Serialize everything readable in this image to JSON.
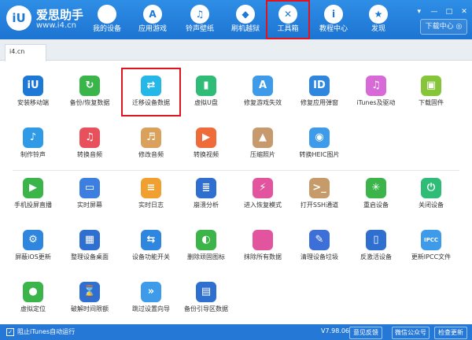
{
  "app": {
    "logo_text": "iU",
    "name": "爱思助手",
    "url": "www.i4.cn"
  },
  "nav": {
    "items": [
      {
        "label": "我的设备",
        "icon": "apple-icon",
        "glyph": ""
      },
      {
        "label": "应用游戏",
        "icon": "app-store-icon",
        "glyph": "A"
      },
      {
        "label": "铃声壁纸",
        "icon": "ringtone-icon",
        "glyph": "♫"
      },
      {
        "label": "刷机越狱",
        "icon": "dropbox-icon",
        "glyph": "◆"
      },
      {
        "label": "工具箱",
        "icon": "tools-icon",
        "glyph": "✕"
      },
      {
        "label": "教程中心",
        "icon": "info-icon",
        "glyph": "i"
      },
      {
        "label": "发现",
        "icon": "star-icon",
        "glyph": "★"
      }
    ],
    "active_index": 4
  },
  "header": {
    "download_label": "下载中心 ◎",
    "window_controls": [
      "▾",
      "—",
      "□",
      "✕"
    ]
  },
  "tabs": [
    {
      "label": "i4.cn"
    }
  ],
  "tools": {
    "rows": [
      [
        {
          "label": "安装移动端",
          "icon": "i4-install-icon",
          "color": "#1e79d6",
          "glyph": "iU"
        },
        {
          "label": "备份/恢复数据",
          "icon": "backup-restore-icon",
          "color": "#39b54a",
          "glyph": "↻"
        },
        {
          "label": "迁移设备数据",
          "icon": "migrate-data-icon",
          "color": "#25b7e8",
          "glyph": "⇄",
          "highlight": true
        },
        {
          "label": "虚拟U盘",
          "icon": "usb-drive-icon",
          "color": "#2ebc76",
          "glyph": "▮"
        },
        {
          "label": "修复游戏失效",
          "icon": "fix-game-icon",
          "color": "#3d9be9",
          "glyph": "A"
        },
        {
          "label": "修复应用弹窗",
          "icon": "fix-app-popup-icon",
          "color": "#2f86de",
          "glyph": "ID"
        },
        {
          "label": "iTunes及驱动",
          "icon": "itunes-driver-icon",
          "color": "#d76ad6",
          "glyph": "♫"
        },
        {
          "label": "下载固件",
          "icon": "firmware-download-icon",
          "color": "#86c53a",
          "glyph": "▣"
        }
      ],
      [
        {
          "label": "制作铃声",
          "icon": "ringtone-maker-icon",
          "color": "#2f9ae5",
          "glyph": "♪"
        },
        {
          "label": "转换音频",
          "icon": "audio-convert-icon",
          "color": "#e8515b",
          "glyph": "♫"
        },
        {
          "label": "修改音频",
          "icon": "audio-edit-icon",
          "color": "#d9a15c",
          "glyph": "♬"
        },
        {
          "label": "转换视频",
          "icon": "video-convert-icon",
          "color": "#ef6b3a",
          "glyph": "▶"
        },
        {
          "label": "压缩照片",
          "icon": "photo-compress-icon",
          "color": "#c69a6d",
          "glyph": "▲"
        },
        {
          "label": "转换HEIC图片",
          "icon": "heic-convert-icon",
          "color": "#3d9be9",
          "glyph": "◉"
        }
      ],
      [
        {
          "label": "手机投屏直播",
          "icon": "screen-mirror-icon",
          "color": "#3bb54a",
          "glyph": "▶"
        },
        {
          "label": "实时屏幕",
          "icon": "realtime-screen-icon",
          "color": "#3d7fe0",
          "glyph": "▭"
        },
        {
          "label": "实时日志",
          "icon": "realtime-log-icon",
          "color": "#f0a030",
          "glyph": "≡"
        },
        {
          "label": "崩溃分析",
          "icon": "crash-analysis-icon",
          "color": "#2f6fd0",
          "glyph": "≣"
        },
        {
          "label": "进入恢复模式",
          "icon": "recovery-mode-icon",
          "color": "#e2559e",
          "glyph": "⚡"
        },
        {
          "label": "打开SSH通道",
          "icon": "ssh-tunnel-icon",
          "color": "#c79a6a",
          "glyph": ">_"
        },
        {
          "label": "重启设备",
          "icon": "restart-device-icon",
          "color": "#3bb54a",
          "glyph": "✳"
        },
        {
          "label": "关闭设备",
          "icon": "shutdown-device-icon",
          "color": "#2ebc76",
          "glyph": "⏻"
        }
      ],
      [
        {
          "label": "屏蔽iOS更新",
          "icon": "block-update-icon",
          "color": "#2f86de",
          "glyph": "⚙"
        },
        {
          "label": "整理设备桌面",
          "icon": "organize-desktop-icon",
          "color": "#2f6fd0",
          "glyph": "▦"
        },
        {
          "label": "设备功能开关",
          "icon": "feature-switch-icon",
          "color": "#2f86de",
          "glyph": "⇆"
        },
        {
          "label": "删除顽固图标",
          "icon": "delete-icon-tool-icon",
          "color": "#3bb54a",
          "glyph": "◐"
        },
        {
          "label": "抹除所有数据",
          "icon": "erase-data-icon",
          "color": "#e2559e",
          "glyph": ""
        },
        {
          "label": "清理设备垃圾",
          "icon": "clean-junk-icon",
          "color": "#3d6fd8",
          "glyph": "✎"
        },
        {
          "label": "反激活设备",
          "icon": "deactivate-device-icon",
          "color": "#2f6fd0",
          "glyph": "▯"
        },
        {
          "label": "更新IPCC文件",
          "icon": "ipcc-update-icon",
          "color": "#3d9be9",
          "glyph": "IPCC"
        }
      ],
      [
        {
          "label": "虚拟定位",
          "icon": "virtual-location-icon",
          "color": "#3bb54a",
          "glyph": "●"
        },
        {
          "label": "破解时间限额",
          "icon": "time-limit-icon",
          "color": "#2f6fd0",
          "glyph": "⌛"
        },
        {
          "label": "跳过设置向导",
          "icon": "skip-setup-icon",
          "color": "#3d9be9",
          "glyph": "»"
        },
        {
          "label": "备份引导区数据",
          "icon": "backup-boot-icon",
          "color": "#2f6fd0",
          "glyph": "▤"
        }
      ]
    ]
  },
  "status": {
    "checkbox_mark": "✓",
    "itunes_autorun": "阻止iTunes自动运行",
    "version": "V7.98.06",
    "buttons": [
      {
        "label": "意见反馈"
      },
      {
        "label": "微信公众号"
      },
      {
        "label": "检查更新"
      }
    ]
  }
}
